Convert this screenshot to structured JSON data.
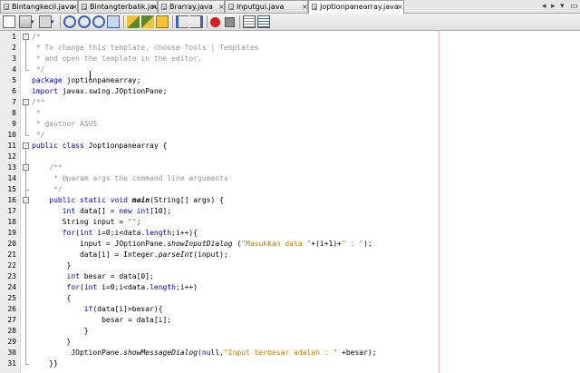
{
  "tabs": [
    {
      "label": "Bintangkecil.java",
      "active": false
    },
    {
      "label": "Bintangterbalik.java",
      "active": false
    },
    {
      "label": "Brarray.java",
      "active": false
    },
    {
      "label": "Inputgui.java",
      "active": false
    },
    {
      "label": "Joptionpanearray.java",
      "active": true
    }
  ],
  "tab_close": "×",
  "toolbar": [
    "source-history-icon",
    "last-edit-icon",
    "back-icon",
    "forward-icon",
    "find-previous-icon",
    "find-next-icon",
    "find-selection-icon",
    "toggle-highlight-icon",
    "previous-bookmark-icon",
    "next-bookmark-icon",
    "toggle-bookmark-icon",
    "shift-left-icon",
    "shift-right-icon",
    "start-macro-icon",
    "stop-macro-icon",
    "comment-icon",
    "uncomment-icon"
  ],
  "colors": {
    "keyword": "#0000e6",
    "comment": "#969696",
    "string": "#ce7b00",
    "margin": "#f0b8b8"
  },
  "code": {
    "lines": [
      {
        "n": "1",
        "tokens": [
          {
            "t": "/*",
            "c": "cm"
          }
        ]
      },
      {
        "n": "2",
        "tokens": [
          {
            "t": " * To change this template, choose Tools | Templates",
            "c": "cm"
          }
        ]
      },
      {
        "n": "3",
        "tokens": [
          {
            "t": " * and open the template in the editor.",
            "c": "cm"
          }
        ]
      },
      {
        "n": "4",
        "tokens": [
          {
            "t": " */",
            "c": "cm"
          }
        ]
      },
      {
        "n": "5",
        "tokens": [
          {
            "t": "package",
            "c": "kw"
          },
          {
            "t": " joptionpanearray;",
            "c": ""
          }
        ]
      },
      {
        "n": "6",
        "tokens": [
          {
            "t": "import",
            "c": "kw"
          },
          {
            "t": " javax.swing.JOptionPane;",
            "c": ""
          }
        ]
      },
      {
        "n": "7",
        "tokens": [
          {
            "t": "/**",
            "c": "cm"
          }
        ]
      },
      {
        "n": "8",
        "tokens": [
          {
            "t": " *",
            "c": "cm"
          }
        ]
      },
      {
        "n": "9",
        "tokens": [
          {
            "t": " * @author ASUS",
            "c": "cm"
          }
        ]
      },
      {
        "n": "10",
        "tokens": [
          {
            "t": " */",
            "c": "cm"
          }
        ]
      },
      {
        "n": "11",
        "tokens": [
          {
            "t": "public class",
            "c": "kw"
          },
          {
            "t": " Joptionpanearray {",
            "c": ""
          }
        ]
      },
      {
        "n": "12",
        "tokens": []
      },
      {
        "n": "13",
        "tokens": [
          {
            "t": "    /**",
            "c": "cm"
          }
        ]
      },
      {
        "n": "14",
        "tokens": [
          {
            "t": "     * @param args the command line arguments",
            "c": "cm"
          }
        ]
      },
      {
        "n": "15",
        "tokens": [
          {
            "t": "     */",
            "c": "cm"
          }
        ]
      },
      {
        "n": "16",
        "tokens": [
          {
            "t": "    ",
            "c": ""
          },
          {
            "t": "public static void",
            "c": "kw"
          },
          {
            "t": " ",
            "c": ""
          },
          {
            "t": "main",
            "c": "bd it"
          },
          {
            "t": "(String[] args) {",
            "c": ""
          }
        ]
      },
      {
        "n": "17",
        "tokens": [
          {
            "t": "       ",
            "c": ""
          },
          {
            "t": "int",
            "c": "kw"
          },
          {
            "t": " data[] = ",
            "c": ""
          },
          {
            "t": "new int",
            "c": "kw"
          },
          {
            "t": "[10];",
            "c": ""
          }
        ]
      },
      {
        "n": "18",
        "tokens": [
          {
            "t": "       String input = ",
            "c": ""
          },
          {
            "t": "\"\"",
            "c": "st"
          },
          {
            "t": ";",
            "c": ""
          }
        ]
      },
      {
        "n": "19",
        "tokens": [
          {
            "t": "       ",
            "c": ""
          },
          {
            "t": "for",
            "c": "kw"
          },
          {
            "t": "(",
            "c": ""
          },
          {
            "t": "int",
            "c": "kw"
          },
          {
            "t": " i=0;i<data.",
            "c": ""
          },
          {
            "t": "length",
            "c": "kw"
          },
          {
            "t": ";i++){",
            "c": ""
          }
        ]
      },
      {
        "n": "20",
        "tokens": [
          {
            "t": "           input = JOptionPane.",
            "c": ""
          },
          {
            "t": "showInputDialog",
            "c": "it"
          },
          {
            "t": " (",
            "c": ""
          },
          {
            "t": "\"Masukkan data \"",
            "c": "st"
          },
          {
            "t": "+(i+1)+",
            "c": ""
          },
          {
            "t": "\" : \"",
            "c": "st"
          },
          {
            "t": ");",
            "c": ""
          }
        ]
      },
      {
        "n": "21",
        "tokens": [
          {
            "t": "           data[i] = Integer.",
            "c": ""
          },
          {
            "t": "parseInt",
            "c": "it"
          },
          {
            "t": "(input);",
            "c": ""
          }
        ]
      },
      {
        "n": "22",
        "tokens": [
          {
            "t": "        }",
            "c": ""
          }
        ]
      },
      {
        "n": "23",
        "tokens": [
          {
            "t": "        ",
            "c": ""
          },
          {
            "t": "int",
            "c": "kw"
          },
          {
            "t": " besar = data[0];",
            "c": ""
          }
        ]
      },
      {
        "n": "24",
        "tokens": [
          {
            "t": "        ",
            "c": ""
          },
          {
            "t": "for",
            "c": "kw"
          },
          {
            "t": "(",
            "c": ""
          },
          {
            "t": "int",
            "c": "kw"
          },
          {
            "t": " i=0;i<data.",
            "c": ""
          },
          {
            "t": "length",
            "c": "kw"
          },
          {
            "t": ";i++)",
            "c": ""
          }
        ]
      },
      {
        "n": "25",
        "tokens": [
          {
            "t": "        {",
            "c": ""
          }
        ]
      },
      {
        "n": "26",
        "tokens": [
          {
            "t": "            ",
            "c": ""
          },
          {
            "t": "if",
            "c": "kw"
          },
          {
            "t": "(data[i]>besar){",
            "c": ""
          }
        ]
      },
      {
        "n": "27",
        "tokens": [
          {
            "t": "                besar = data[i];",
            "c": ""
          }
        ]
      },
      {
        "n": "28",
        "tokens": [
          {
            "t": "            }",
            "c": ""
          }
        ]
      },
      {
        "n": "29",
        "tokens": [
          {
            "t": "        }",
            "c": ""
          }
        ]
      },
      {
        "n": "30",
        "tokens": [
          {
            "t": "         JOptionPane.",
            "c": ""
          },
          {
            "t": "showMessageDialog",
            "c": "it"
          },
          {
            "t": "(",
            "c": ""
          },
          {
            "t": "null",
            "c": "kw"
          },
          {
            "t": ",",
            "c": ""
          },
          {
            "t": "\"Input terbesar adalah : \"",
            "c": "st"
          },
          {
            "t": " +besar);",
            "c": ""
          }
        ]
      },
      {
        "n": "31",
        "tokens": [
          {
            "t": "    }}",
            "c": ""
          }
        ]
      }
    ]
  }
}
